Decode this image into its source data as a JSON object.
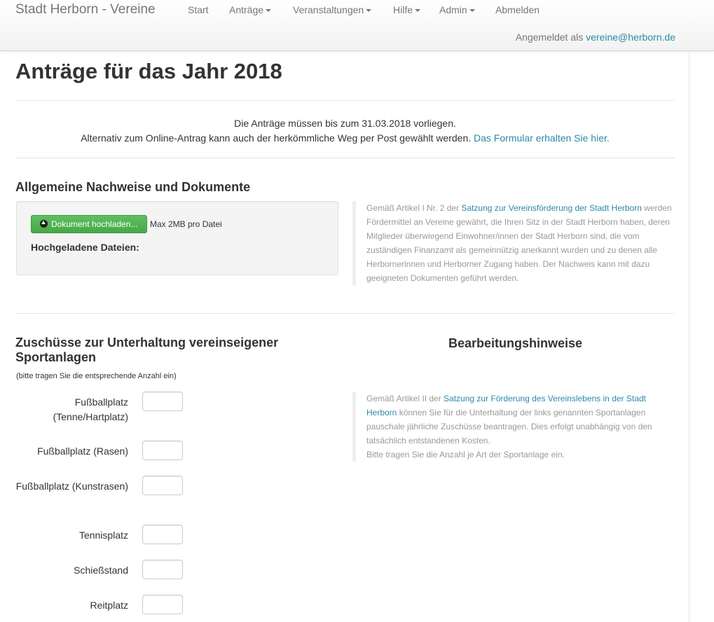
{
  "navbar": {
    "brand": "Stadt Herborn - Vereine",
    "items": [
      {
        "label": "Start",
        "dropdown": false
      },
      {
        "label": "Anträge",
        "dropdown": true
      },
      {
        "label": "Veranstaltungen",
        "dropdown": true
      },
      {
        "label": "Hilfe",
        "dropdown": true
      },
      {
        "label": "Admin",
        "dropdown": true
      },
      {
        "label": "Abmelden",
        "dropdown": false
      }
    ],
    "logged_in_prefix": "Angemeldet als",
    "logged_in_user": "vereine@herborn.de"
  },
  "page": {
    "title": "Anträge für das Jahr 2018",
    "deadline_line1": "Die Anträge müssen bis zum 31.03.2018 vorliegen.",
    "deadline_line2": "Alternativ zum Online-Antrag kann auch der herkömmliche Weg per Post gewählt werden.",
    "deadline_link": "Das Formular erhalten Sie hier."
  },
  "documents": {
    "heading": "Allgemeine Nachweise und Dokumente",
    "upload_button": "Dokument hochladen...",
    "max_size": "Max 2MB pro Datei",
    "uploaded_heading": "Hochgeladene Dateien:",
    "note_prefix": "Gemäß Artikel I Nr. 2 der",
    "note_link": "Satzung zur Vereinsförderung der Stadt Herborn",
    "note_suffix": "werden Fördermittel an Vereine gewährt, die Ihren Sitz in der Stadt Herborn haben, deren Mitglieder überwiegend Einwohner/innen der Stadt Herborn sind, die vom zuständigen Finanzamt als gemeinnützig anerkannt wurden und zu denen alle Herbornerinnen und Herborner Zugang haben. Der Nachweis kann mit dazu geeigneten Dokumenten geführt werden."
  },
  "sports": {
    "heading": "Zuschüsse zur Unterhaltung vereinseigener Sportanlagen",
    "hint": "(bitte tragen Sie die entsprechende Anzahl ein)",
    "fields": [
      {
        "label": "Fußballplatz (Tenne/Hartplatz)",
        "value": ""
      },
      {
        "label": "Fußballplatz (Rasen)",
        "value": ""
      },
      {
        "label": "Fußballplatz (Kunstrasen)",
        "value": ""
      },
      {
        "label": "Tennisplatz",
        "value": ""
      },
      {
        "label": "Schießstand",
        "value": ""
      },
      {
        "label": "Reitplatz",
        "value": ""
      }
    ]
  },
  "processing": {
    "heading": "Bearbeitungshinweise",
    "note_prefix": "Gemäß Artikel II der",
    "note_link": "Satzung zur Förderung des Vereinslebens in der Stadt Herborn",
    "note_suffix": "können Sie für die Unterhaltung der links genannten Sportanlagen pauschale jährliche Zuschüsse beantragen. Dies erfolgt unabhängig von den tatsächlich entstandenen Kosten.",
    "note_line2": "Bitte tragen Sie die Anzahl je Art der Sportanlage ein."
  },
  "colors": {
    "link": "#2a8aa8",
    "upload_button": "#4cae4c",
    "muted_text": "#999999"
  }
}
